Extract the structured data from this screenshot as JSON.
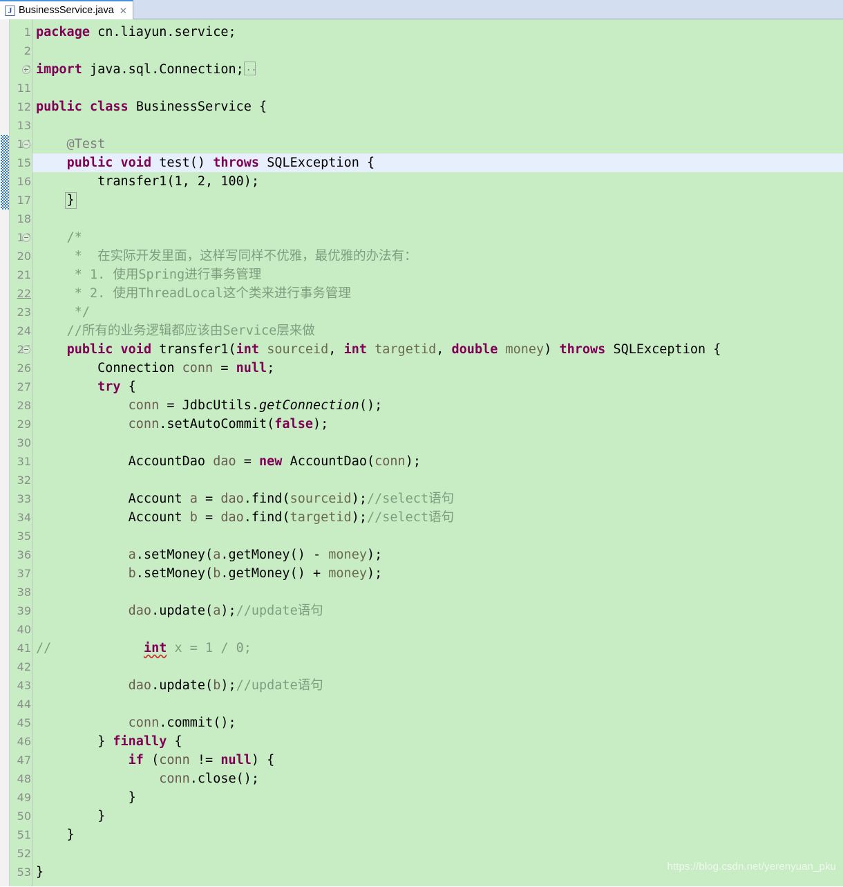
{
  "window": {
    "app": "Eclipse IDE Java Editor",
    "background_color": "#c8ecc4",
    "current_line_highlight_color": "#e8effc"
  },
  "tab": {
    "title": "BusinessService.java",
    "close_label": "✕",
    "icon": "java-file-icon"
  },
  "editor": {
    "first_line": 1,
    "last_line": 53,
    "current_line": 15,
    "change_bar_lines": [
      14,
      15,
      16,
      17
    ],
    "fold_markers": [
      {
        "line": 3,
        "type": "plus"
      },
      {
        "line": 14,
        "type": "minus"
      },
      {
        "line": 19,
        "type": "minus"
      },
      {
        "line": 25,
        "type": "minus"
      }
    ],
    "underlined_line_numbers": [
      22
    ],
    "colors": {
      "keyword": "#7f0055",
      "comment": "#7f9e7f",
      "annotation": "#808080",
      "parameter": "#6a6a50",
      "local_variable": "#6a5c50",
      "plain_text": "#000000",
      "line_number": "#8a8f8a",
      "gutter_separator": "#b7c9b5",
      "change_bar": "#1a72c4"
    },
    "lines": [
      {
        "n": 1,
        "text": "package cn.liayun.service;"
      },
      {
        "n": 2,
        "text": ""
      },
      {
        "n": 3,
        "text": "import java.sql.Connection;"
      },
      {
        "n": 11,
        "text": ""
      },
      {
        "n": 12,
        "text": "public class BusinessService {"
      },
      {
        "n": 13,
        "text": ""
      },
      {
        "n": 14,
        "text": "    @Test"
      },
      {
        "n": 15,
        "text": "    public void test() throws SQLException {"
      },
      {
        "n": 16,
        "text": "        transfer1(1, 2, 100);"
      },
      {
        "n": 17,
        "text": "    }"
      },
      {
        "n": 18,
        "text": ""
      },
      {
        "n": 19,
        "text": "    /*"
      },
      {
        "n": 20,
        "text": "     *  在实际开发里面，这样写同样不优雅，最优雅的办法有："
      },
      {
        "n": 21,
        "text": "     * 1. 使用Spring进行事务管理"
      },
      {
        "n": 22,
        "text": "     * 2. 使用ThreadLocal这个类来进行事务管理"
      },
      {
        "n": 23,
        "text": "     */"
      },
      {
        "n": 24,
        "text": "    //所有的业务逻辑都应该由Service层来做"
      },
      {
        "n": 25,
        "text": "    public void transfer1(int sourceid, int targetid, double money) throws SQLException {"
      },
      {
        "n": 26,
        "text": "        Connection conn = null;"
      },
      {
        "n": 27,
        "text": "        try {"
      },
      {
        "n": 28,
        "text": "            conn = JdbcUtils.getConnection();"
      },
      {
        "n": 29,
        "text": "            conn.setAutoCommit(false);"
      },
      {
        "n": 30,
        "text": ""
      },
      {
        "n": 31,
        "text": "            AccountDao dao = new AccountDao(conn);"
      },
      {
        "n": 32,
        "text": ""
      },
      {
        "n": 33,
        "text": "            Account a = dao.find(sourceid);//select语句"
      },
      {
        "n": 34,
        "text": "            Account b = dao.find(targetid);//select语句"
      },
      {
        "n": 35,
        "text": ""
      },
      {
        "n": 36,
        "text": "            a.setMoney(a.getMoney() - money);"
      },
      {
        "n": 37,
        "text": "            b.setMoney(b.getMoney() + money);"
      },
      {
        "n": 38,
        "text": ""
      },
      {
        "n": 39,
        "text": "            dao.update(a);//update语句"
      },
      {
        "n": 40,
        "text": ""
      },
      {
        "n": 41,
        "text": "//            int x = 1 / 0;"
      },
      {
        "n": 42,
        "text": ""
      },
      {
        "n": 43,
        "text": "            dao.update(b);//update语句"
      },
      {
        "n": 44,
        "text": ""
      },
      {
        "n": 45,
        "text": "            conn.commit();"
      },
      {
        "n": 46,
        "text": "        } finally {"
      },
      {
        "n": 47,
        "text": "            if (conn != null) {"
      },
      {
        "n": 48,
        "text": "                conn.close();"
      },
      {
        "n": 49,
        "text": "            }"
      },
      {
        "n": 50,
        "text": "        }"
      },
      {
        "n": 51,
        "text": "    }"
      },
      {
        "n": 52,
        "text": ""
      },
      {
        "n": 53,
        "text": "}"
      }
    ]
  },
  "watermark": {
    "text": "https://blog.csdn.net/yerenyuan_pku"
  }
}
